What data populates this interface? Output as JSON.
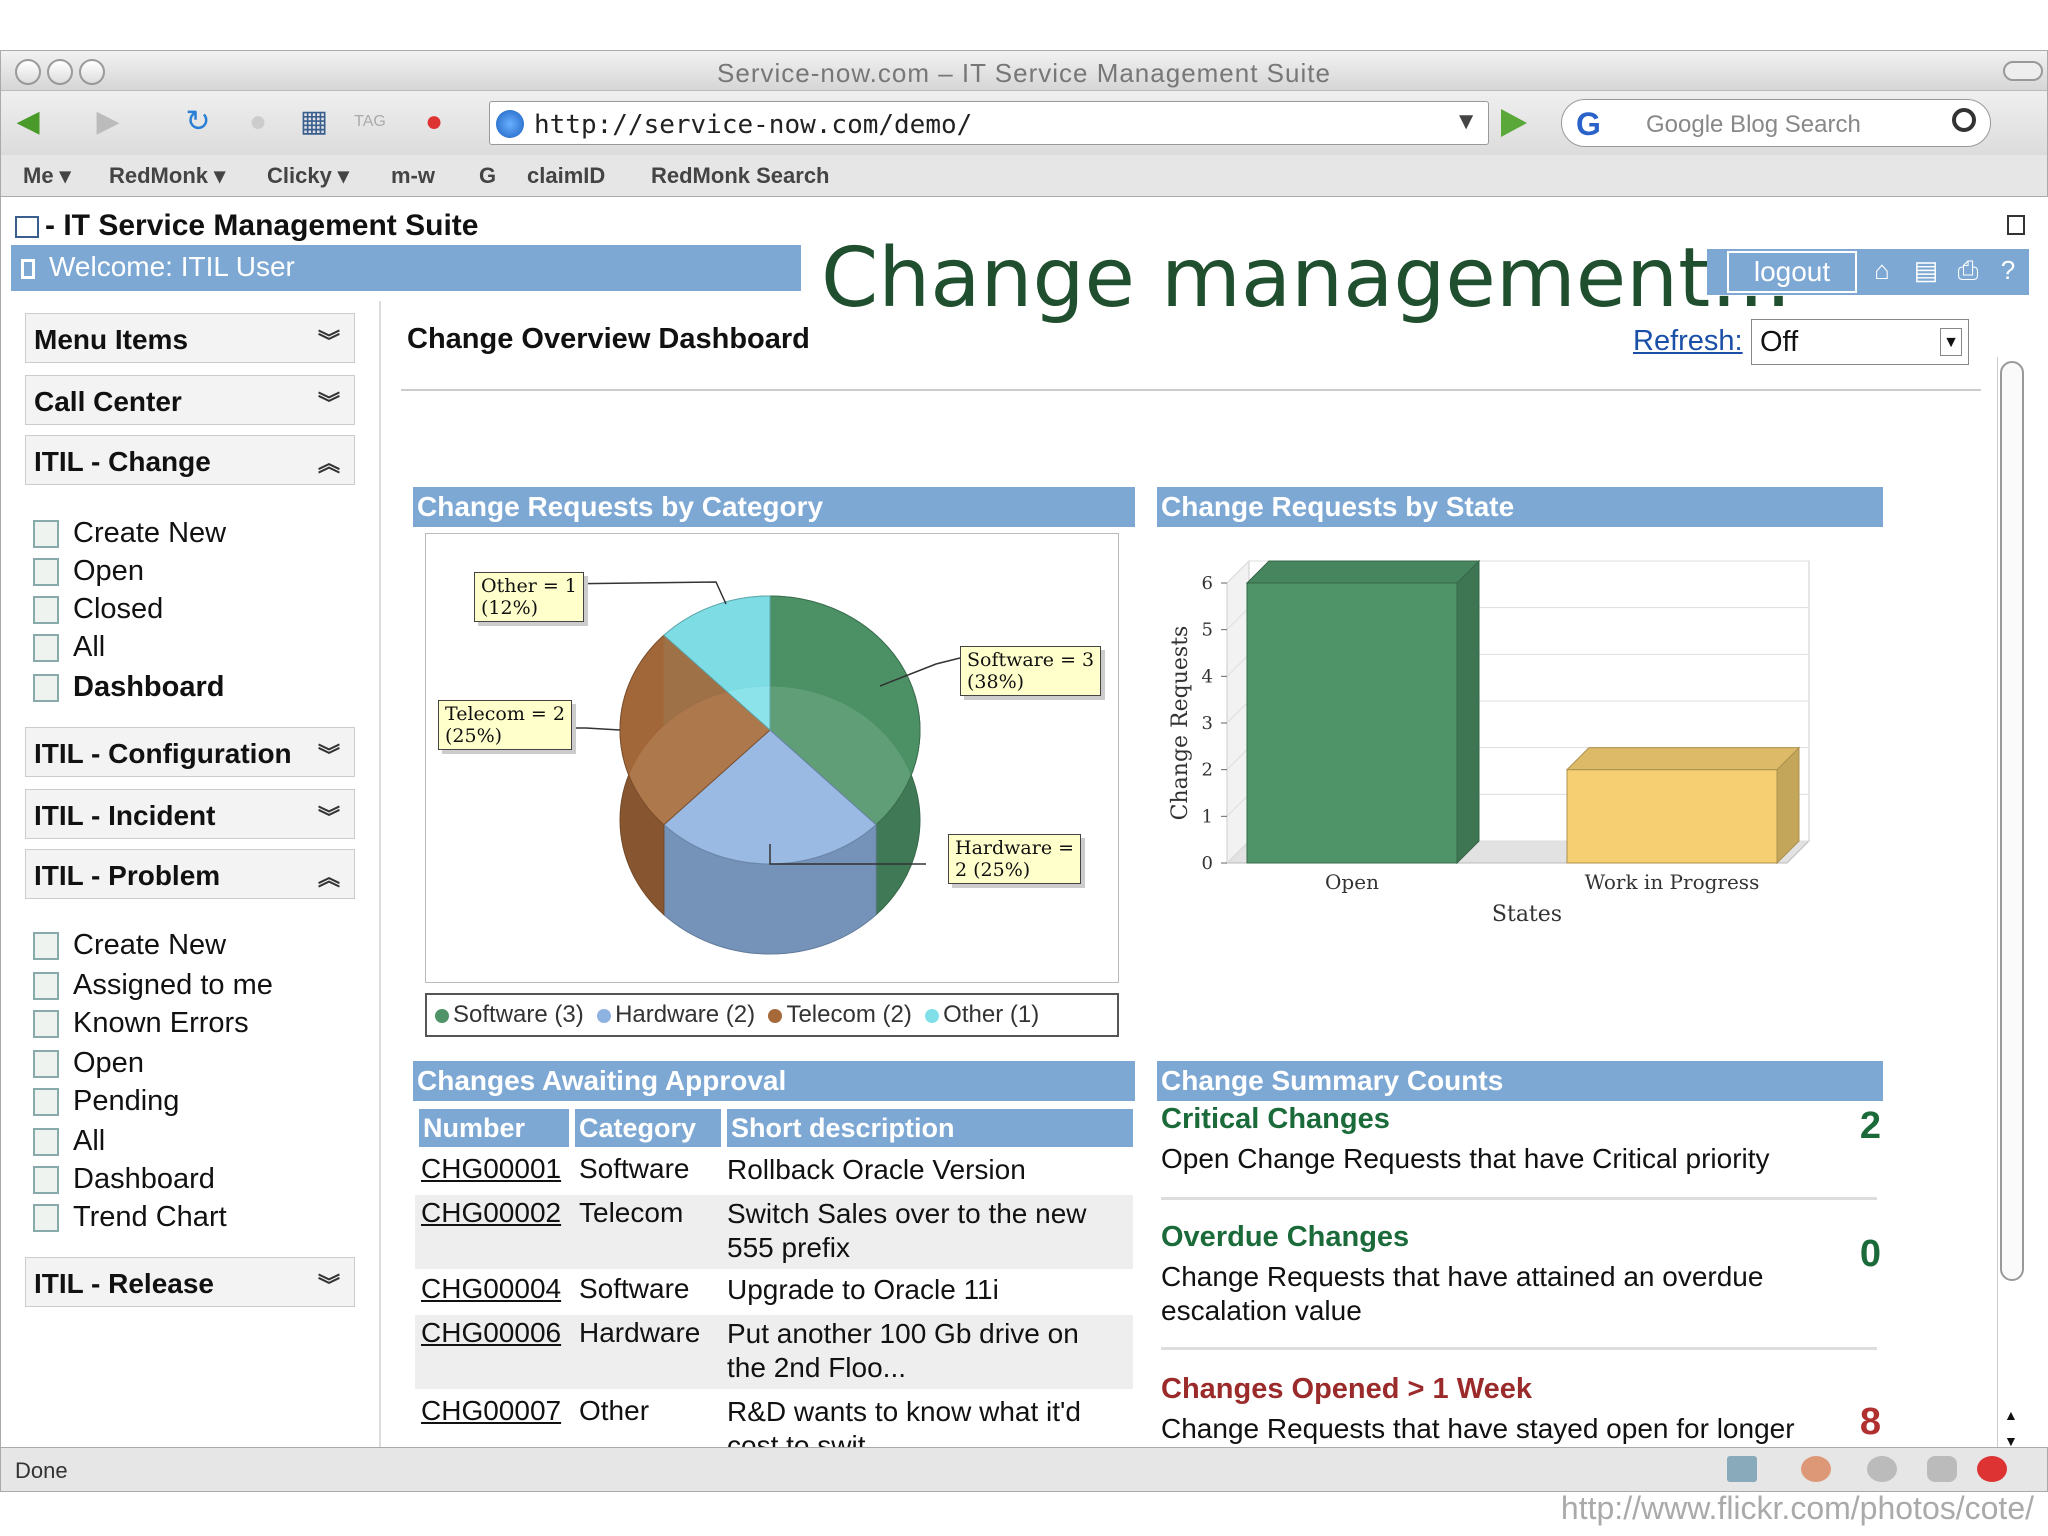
{
  "window": {
    "title": "Service-now.com – IT Service Management Suite"
  },
  "browser": {
    "url": "http://service-now.com/demo/",
    "search_placeholder": "Google Blog Search",
    "bookmarks": [
      "Me ▾",
      "RedMonk ▾",
      "Clicky ▾",
      "m-w",
      "G",
      "claimID",
      "RedMonk Search"
    ],
    "status": "Done"
  },
  "app": {
    "title": "- IT Service Management Suite",
    "welcome": "Welcome: ITIL User",
    "logout_label": "logout",
    "overlay_title": "Change management…"
  },
  "sidebar": {
    "sections": [
      {
        "label": "Menu Items",
        "chev": "»"
      },
      {
        "label": "Call Center",
        "chev": "»"
      },
      {
        "label": "ITIL - Change",
        "chev": "«"
      },
      {
        "label": "ITIL - Configuration",
        "chev": "»"
      },
      {
        "label": "ITIL - Incident",
        "chev": "»"
      },
      {
        "label": "ITIL - Problem",
        "chev": "«"
      },
      {
        "label": "ITIL - Release",
        "chev": "»"
      }
    ],
    "change_items": [
      "Create New",
      "Open",
      "Closed",
      "All",
      "Dashboard"
    ],
    "problem_items": [
      "Create New",
      "Assigned to me",
      "Known Errors",
      "Open",
      "Pending",
      "All",
      "Dashboard",
      "Trend Chart"
    ]
  },
  "main": {
    "title": "Change Overview Dashboard",
    "refresh_label": "Refresh:",
    "refresh_value": "Off",
    "panels": {
      "by_category": "Change Requests by Category",
      "by_state": "Change Requests by State",
      "awaiting": "Changes Awaiting Approval",
      "summary": "Change Summary Counts"
    }
  },
  "chart_data": [
    {
      "type": "pie",
      "title": "Change Requests by Category",
      "slices": [
        {
          "label": "Software",
          "value": 3,
          "percent": "38%",
          "color": "#4e9468"
        },
        {
          "label": "Hardware",
          "value": 2,
          "percent": "25%",
          "color": "#8fb3e0"
        },
        {
          "label": "Telecom",
          "value": 2,
          "percent": "25%",
          "color": "#a5693a"
        },
        {
          "label": "Other",
          "value": 1,
          "percent": "12%",
          "color": "#7fe0e8"
        }
      ],
      "callouts": [
        {
          "line1": "Other = 1",
          "line2": "(12%)"
        },
        {
          "line1": "Software = 3",
          "line2": "(38%)"
        },
        {
          "line1": "Telecom = 2",
          "line2": "(25%)"
        },
        {
          "line1": "Hardware =",
          "line2": "2 (25%)"
        }
      ],
      "legend": [
        "Software (3)",
        "Hardware (2)",
        "Telecom (2)",
        "Other (1)"
      ]
    },
    {
      "type": "bar",
      "title": "Change Requests by State",
      "categories": [
        "Open",
        "Work in Progress"
      ],
      "values": [
        6,
        2
      ],
      "colors": [
        "#4e9468",
        "#f5cf72"
      ],
      "xlabel": "States",
      "ylabel": "Change Requests",
      "ylim": [
        0,
        6
      ],
      "yticks": [
        "0",
        "1",
        "2",
        "3",
        "4",
        "5",
        "6"
      ],
      "grid": true
    }
  ],
  "table": {
    "headers": [
      "Number",
      "Category",
      "Short description"
    ],
    "rows": [
      {
        "number": "CHG00001",
        "category": "Software",
        "desc": "Rollback Oracle Version"
      },
      {
        "number": "CHG00002",
        "category": "Telecom",
        "desc": "Switch Sales over to the new 555 prefix"
      },
      {
        "number": "CHG00004",
        "category": "Software",
        "desc": "Upgrade to Oracle 11i"
      },
      {
        "number": "CHG00006",
        "category": "Hardware",
        "desc": "Put another 100 Gb drive on the 2nd Floo..."
      },
      {
        "number": "CHG00007",
        "category": "Other",
        "desc": "R&D wants to know what it'd cost to swit..."
      }
    ]
  },
  "summary": [
    {
      "title": "Critical Changes",
      "desc": "Open Change Requests that have Critical priority",
      "count": "2",
      "color": "#1b6b3a"
    },
    {
      "title": "Overdue Changes",
      "desc": "Change Requests that have attained an overdue escalation value",
      "count": "0",
      "color": "#1b6b3a"
    },
    {
      "title": "Changes Opened > 1 Week",
      "desc": "Change Requests that have stayed open for longer than a week",
      "count": "8",
      "color": "#b03030"
    }
  ],
  "credit": "http://www.flickr.com/photos/cote/"
}
